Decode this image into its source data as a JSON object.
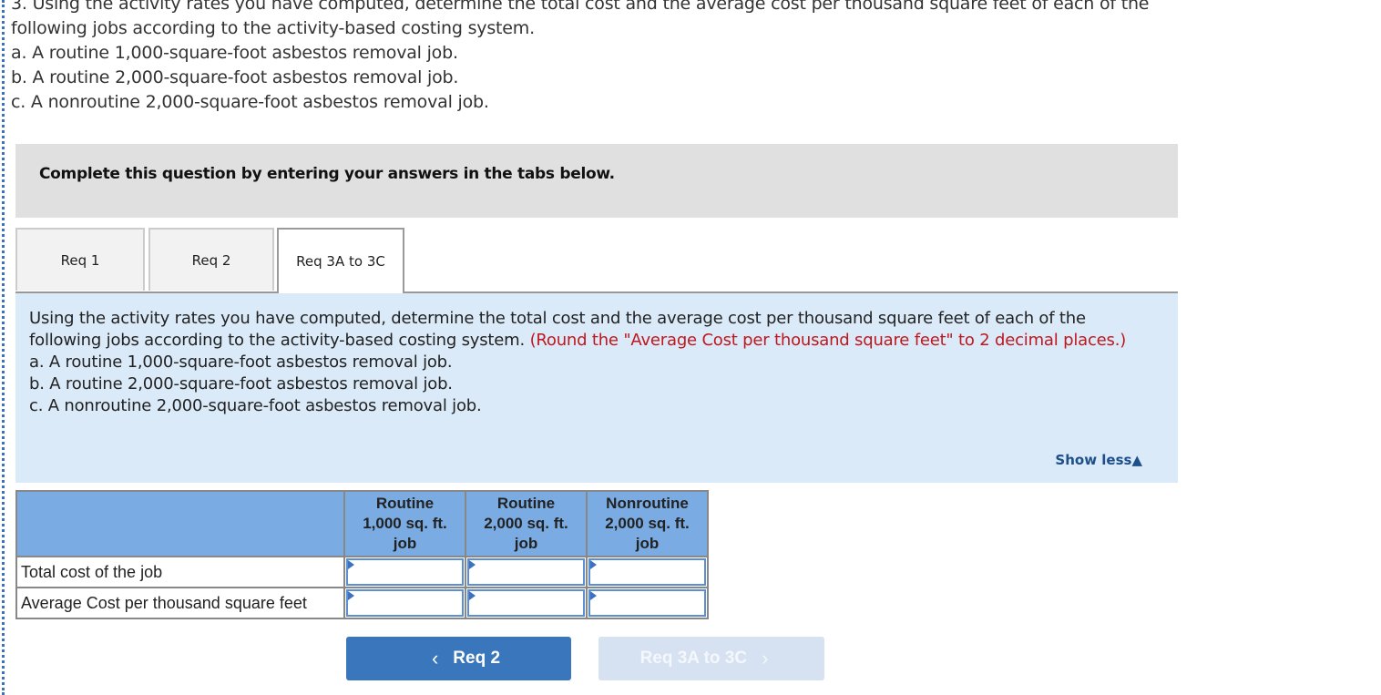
{
  "intro": {
    "lines": [
      "3. Using the activity rates you have computed, determine the total cost and the average cost per thousand square feet of each of the",
      "following jobs according to the activity-based costing system.",
      "a. A routine 1,000-square-foot asbestos removal job.",
      "b. A routine 2,000-square-foot asbestos removal job.",
      "c. A nonroutine 2,000-square-foot asbestos removal job."
    ]
  },
  "banner": {
    "text": "Complete this question by entering your answers in the tabs below."
  },
  "tabs": [
    {
      "label": "Req 1",
      "active": false
    },
    {
      "label": "Req 2",
      "active": false
    },
    {
      "label": "Req 3A to 3C",
      "active": true
    }
  ],
  "panel": {
    "instruction": "Using the activity rates you have computed, determine the total cost and the average cost per thousand square feet of each of the following jobs according to the activity-based costing system.",
    "note": "(Round the \"Average Cost per thousand square feet\" to 2 decimal places.)",
    "items": [
      "a. A routine 1,000-square-foot asbestos removal job.",
      "b. A routine 2,000-square-foot asbestos removal job.",
      "c. A nonroutine 2,000-square-foot asbestos removal job."
    ],
    "show_less": "Show less",
    "show_less_icon": "▲"
  },
  "table": {
    "columns": [
      {
        "line1": "Routine",
        "line2": "1,000 sq. ft.",
        "line3": "job"
      },
      {
        "line1": "Routine",
        "line2": "2,000 sq. ft.",
        "line3": "job"
      },
      {
        "line1": "Nonroutine",
        "line2": "2,000 sq. ft.",
        "line3": "job"
      }
    ],
    "rows": [
      {
        "label": "Total cost of the job",
        "values": [
          "",
          "",
          ""
        ]
      },
      {
        "label": "Average Cost per thousand square feet",
        "values": [
          "",
          "",
          ""
        ]
      }
    ]
  },
  "nav": {
    "prev_label": "Req 2",
    "prev_icon": "‹",
    "next_label": "Req 3A to 3C",
    "next_icon": "›"
  },
  "colors": {
    "header_blue": "#7aace3",
    "panel_blue": "#daeaf8",
    "button_blue": "#3a76bb",
    "note_red": "#c0171d"
  }
}
